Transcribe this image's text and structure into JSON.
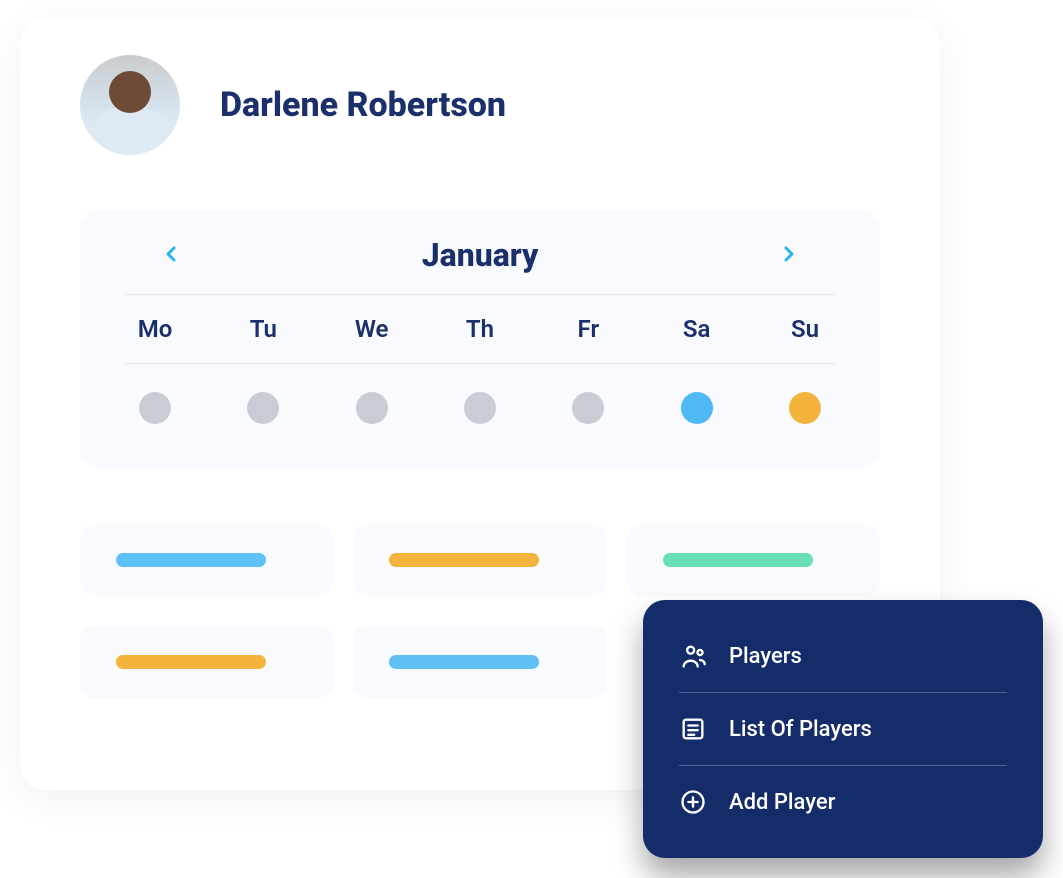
{
  "profile": {
    "name": "Darlene Robertson"
  },
  "calendar": {
    "month_label": "January",
    "weekdays": [
      "Mo",
      "Tu",
      "We",
      "Th",
      "Fr",
      "Sa",
      "Su"
    ],
    "day_markers": [
      {
        "color": "#C8CCD4"
      },
      {
        "color": "#C8CCD4"
      },
      {
        "color": "#C8CCD4"
      },
      {
        "color": "#C8CCD4"
      },
      {
        "color": "#C8CCD4"
      },
      {
        "color": "#4FB9F4"
      },
      {
        "color": "#F3B33D"
      }
    ]
  },
  "events": [
    {
      "color": "#5FC0F4"
    },
    {
      "color": "#F3B33D"
    },
    {
      "color": "#67E0B6"
    },
    {
      "color": "#F3B33D"
    },
    {
      "color": "#5FC0F4"
    },
    {
      "color": ""
    }
  ],
  "menu": {
    "items": [
      {
        "icon": "players",
        "label": "Players"
      },
      {
        "icon": "list",
        "label": "List Of Players"
      },
      {
        "icon": "add",
        "label": "Add Player"
      }
    ]
  }
}
